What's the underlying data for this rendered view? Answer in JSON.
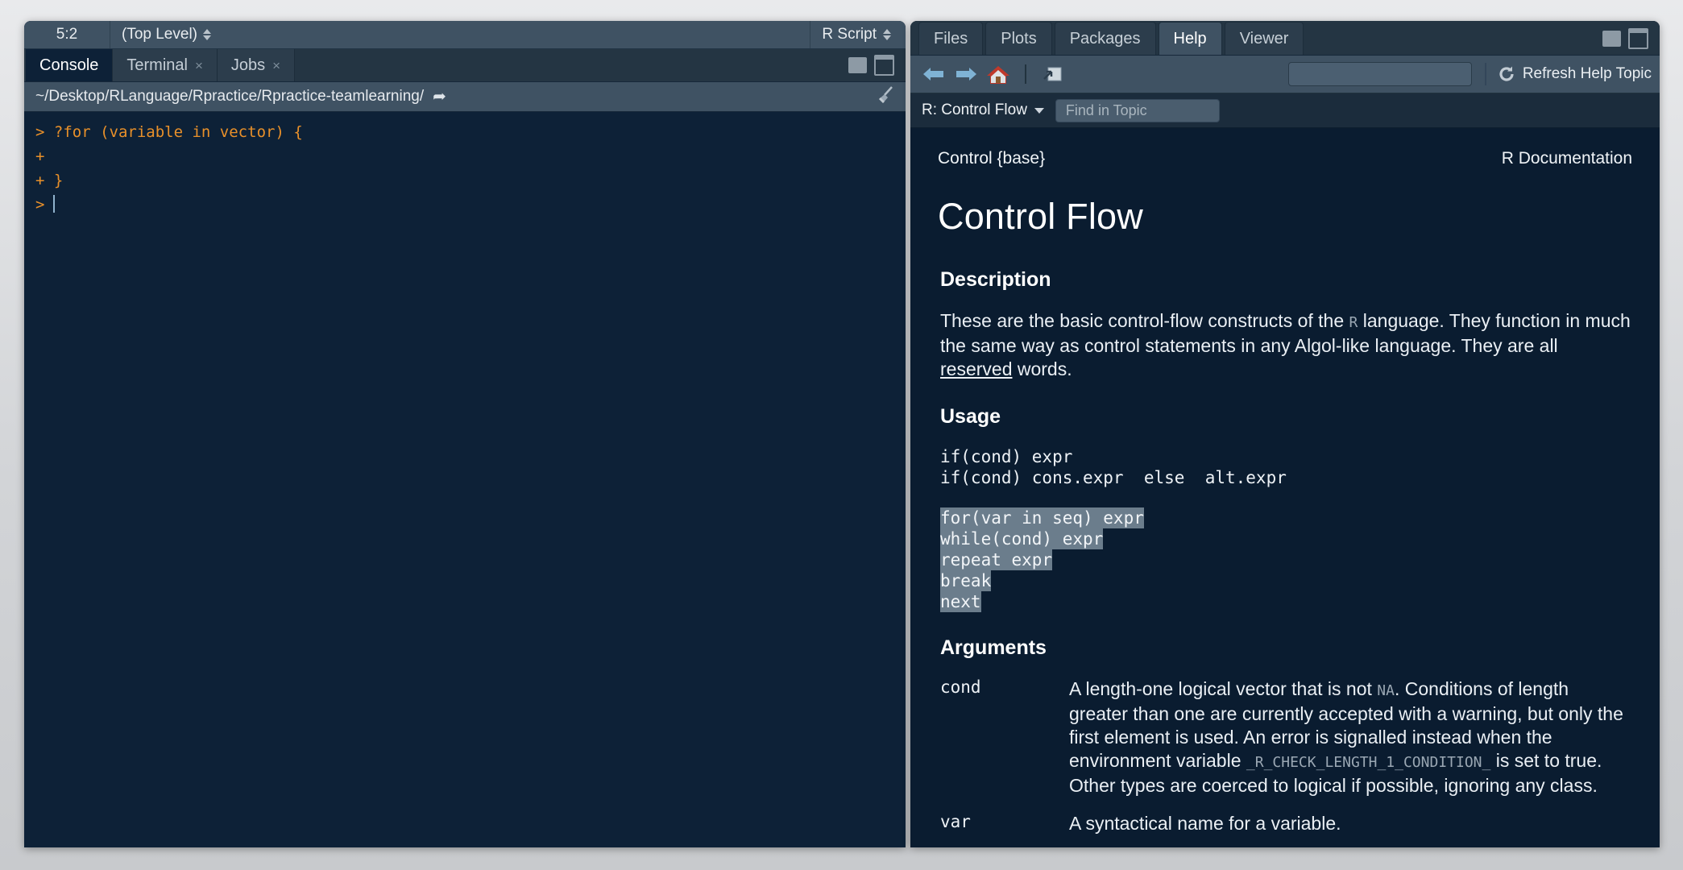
{
  "source_status": {
    "cursor_position": "5:2",
    "scope": "(Top Level)",
    "file_type": "R Script"
  },
  "console_pane": {
    "tabs": [
      {
        "label": "Console",
        "closable": false,
        "active": true
      },
      {
        "label": "Terminal",
        "closable": true,
        "active": false
      },
      {
        "label": "Jobs",
        "closable": true,
        "active": false
      }
    ],
    "close_glyph": "×",
    "working_directory": "~/Desktop/RLanguage/Rpractice/Rpractice-teamlearning/",
    "open_dir_glyph": "➦",
    "lines": [
      {
        "prompt": ">",
        "text": "?for (variable in vector) {"
      },
      {
        "prompt": "+",
        "text": ""
      },
      {
        "prompt": "+",
        "text": "}"
      },
      {
        "prompt": ">",
        "text": ""
      }
    ]
  },
  "help_pane": {
    "tabs": [
      {
        "label": "Files",
        "active": false
      },
      {
        "label": "Plots",
        "active": false
      },
      {
        "label": "Packages",
        "active": false
      },
      {
        "label": "Help",
        "active": true
      },
      {
        "label": "Viewer",
        "active": false
      }
    ],
    "toolbar": {
      "back_title": "Back",
      "forward_title": "Forward",
      "home_title": "Home",
      "popout_title": "Show in new window",
      "search_value": "",
      "search_placeholder": "",
      "refresh_label": "Refresh Help Topic"
    },
    "topic_bar": {
      "topic": "R: Control Flow",
      "find_value": "",
      "find_placeholder": "Find in Topic"
    }
  },
  "document": {
    "header_left": "Control {base}",
    "header_right": "R Documentation",
    "title": "Control Flow",
    "sections": {
      "description": {
        "heading": "Description",
        "text_1": "These are the basic control-flow constructs of the ",
        "inline_code": "R",
        "text_2": " language. They function in much the same way as control statements in any Algol-like language. They are all ",
        "link": "reserved",
        "text_3": " words."
      },
      "usage": {
        "heading": "Usage",
        "plain_lines": [
          "if(cond) expr",
          "if(cond) cons.expr  else  alt.expr"
        ],
        "highlighted_lines": [
          "for(var in seq) expr",
          "while(cond) expr",
          "repeat expr",
          "break",
          "next"
        ]
      },
      "arguments": {
        "heading": "Arguments",
        "rows": [
          {
            "name": "cond",
            "desc_1": "A length-one logical vector that is not ",
            "code_1": "NA",
            "desc_2": ". Conditions of length greater than one are currently accepted with a warning, but only the first element is used. An error is signalled instead when the environment variable ",
            "code_2": "_R_CHECK_LENGTH_1_CONDITION_",
            "desc_3": " is set to true. Other types are coerced to logical if possible, ignoring any class."
          },
          {
            "name": "var",
            "desc_1": "A syntactical name for a variable.",
            "code_1": "",
            "desc_2": "",
            "code_2": "",
            "desc_3": ""
          }
        ]
      }
    }
  },
  "colors": {
    "console_bg": "#0d2137",
    "help_bg": "#0a1c30",
    "toolbar_bg": "#3f5263",
    "tabstrip_bg": "#243543",
    "prompt_orange": "#e8902a",
    "highlight": "#6b7d8c",
    "home_roof": "#c0392b",
    "nav_blue": "#7fb3d5"
  }
}
